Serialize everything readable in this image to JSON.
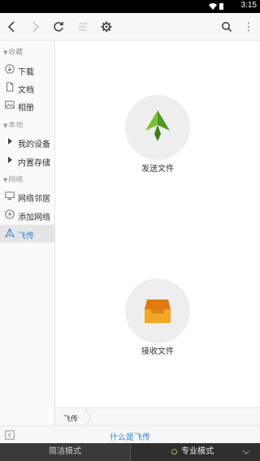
{
  "status": {
    "time": "3:15"
  },
  "sidebar": {
    "sections": [
      {
        "label": "收藏"
      },
      {
        "label": "本地"
      },
      {
        "label": "网络"
      }
    ],
    "items": [
      {
        "label": "下载",
        "icon": "download-icon"
      },
      {
        "label": "文档",
        "icon": "document-icon"
      },
      {
        "label": "相册",
        "icon": "album-icon"
      },
      {
        "label": "我的设备",
        "icon": "expand-arrow-icon"
      },
      {
        "label": "内置存储",
        "icon": "expand-arrow-icon"
      },
      {
        "label": "网络邻居",
        "icon": "monitor-icon"
      },
      {
        "label": "添加网络",
        "icon": "add-circle-icon"
      },
      {
        "label": "飞传",
        "icon": "send-icon",
        "active": true
      }
    ]
  },
  "main": {
    "send_label": "发送文件",
    "receive_label": "接收文件"
  },
  "pathbar": {
    "crumb": "飞传"
  },
  "help": {
    "link": "什么是飞传"
  },
  "modes": {
    "simple": "简洁模式",
    "pro": "专业模式"
  },
  "colors": {
    "accent": "#2a85d6",
    "send_green": "#6aaa2a",
    "receive_orange": "#f0a020"
  }
}
